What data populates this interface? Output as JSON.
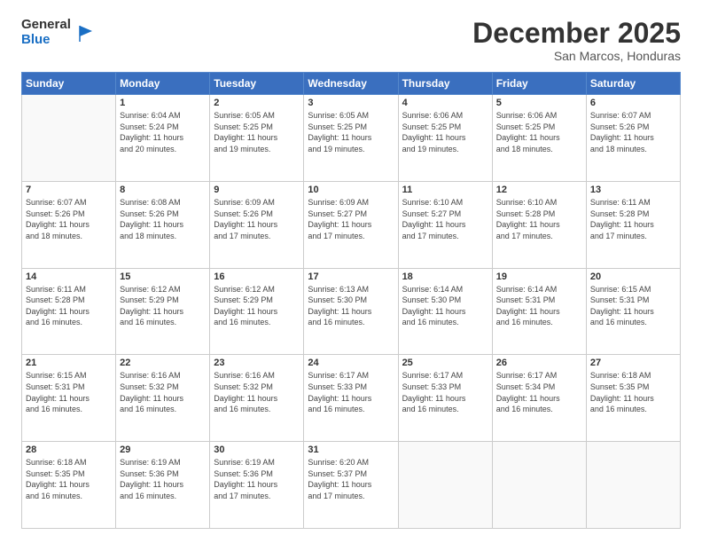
{
  "header": {
    "logo_general": "General",
    "logo_blue": "Blue",
    "month_title": "December 2025",
    "location": "San Marcos, Honduras"
  },
  "weekdays": [
    "Sunday",
    "Monday",
    "Tuesday",
    "Wednesday",
    "Thursday",
    "Friday",
    "Saturday"
  ],
  "weeks": [
    [
      {
        "day": "",
        "info": ""
      },
      {
        "day": "1",
        "info": "Sunrise: 6:04 AM\nSunset: 5:24 PM\nDaylight: 11 hours\nand 20 minutes."
      },
      {
        "day": "2",
        "info": "Sunrise: 6:05 AM\nSunset: 5:25 PM\nDaylight: 11 hours\nand 19 minutes."
      },
      {
        "day": "3",
        "info": "Sunrise: 6:05 AM\nSunset: 5:25 PM\nDaylight: 11 hours\nand 19 minutes."
      },
      {
        "day": "4",
        "info": "Sunrise: 6:06 AM\nSunset: 5:25 PM\nDaylight: 11 hours\nand 19 minutes."
      },
      {
        "day": "5",
        "info": "Sunrise: 6:06 AM\nSunset: 5:25 PM\nDaylight: 11 hours\nand 18 minutes."
      },
      {
        "day": "6",
        "info": "Sunrise: 6:07 AM\nSunset: 5:26 PM\nDaylight: 11 hours\nand 18 minutes."
      }
    ],
    [
      {
        "day": "7",
        "info": "Sunrise: 6:07 AM\nSunset: 5:26 PM\nDaylight: 11 hours\nand 18 minutes."
      },
      {
        "day": "8",
        "info": "Sunrise: 6:08 AM\nSunset: 5:26 PM\nDaylight: 11 hours\nand 18 minutes."
      },
      {
        "day": "9",
        "info": "Sunrise: 6:09 AM\nSunset: 5:26 PM\nDaylight: 11 hours\nand 17 minutes."
      },
      {
        "day": "10",
        "info": "Sunrise: 6:09 AM\nSunset: 5:27 PM\nDaylight: 11 hours\nand 17 minutes."
      },
      {
        "day": "11",
        "info": "Sunrise: 6:10 AM\nSunset: 5:27 PM\nDaylight: 11 hours\nand 17 minutes."
      },
      {
        "day": "12",
        "info": "Sunrise: 6:10 AM\nSunset: 5:28 PM\nDaylight: 11 hours\nand 17 minutes."
      },
      {
        "day": "13",
        "info": "Sunrise: 6:11 AM\nSunset: 5:28 PM\nDaylight: 11 hours\nand 17 minutes."
      }
    ],
    [
      {
        "day": "14",
        "info": "Sunrise: 6:11 AM\nSunset: 5:28 PM\nDaylight: 11 hours\nand 16 minutes."
      },
      {
        "day": "15",
        "info": "Sunrise: 6:12 AM\nSunset: 5:29 PM\nDaylight: 11 hours\nand 16 minutes."
      },
      {
        "day": "16",
        "info": "Sunrise: 6:12 AM\nSunset: 5:29 PM\nDaylight: 11 hours\nand 16 minutes."
      },
      {
        "day": "17",
        "info": "Sunrise: 6:13 AM\nSunset: 5:30 PM\nDaylight: 11 hours\nand 16 minutes."
      },
      {
        "day": "18",
        "info": "Sunrise: 6:14 AM\nSunset: 5:30 PM\nDaylight: 11 hours\nand 16 minutes."
      },
      {
        "day": "19",
        "info": "Sunrise: 6:14 AM\nSunset: 5:31 PM\nDaylight: 11 hours\nand 16 minutes."
      },
      {
        "day": "20",
        "info": "Sunrise: 6:15 AM\nSunset: 5:31 PM\nDaylight: 11 hours\nand 16 minutes."
      }
    ],
    [
      {
        "day": "21",
        "info": "Sunrise: 6:15 AM\nSunset: 5:31 PM\nDaylight: 11 hours\nand 16 minutes."
      },
      {
        "day": "22",
        "info": "Sunrise: 6:16 AM\nSunset: 5:32 PM\nDaylight: 11 hours\nand 16 minutes."
      },
      {
        "day": "23",
        "info": "Sunrise: 6:16 AM\nSunset: 5:32 PM\nDaylight: 11 hours\nand 16 minutes."
      },
      {
        "day": "24",
        "info": "Sunrise: 6:17 AM\nSunset: 5:33 PM\nDaylight: 11 hours\nand 16 minutes."
      },
      {
        "day": "25",
        "info": "Sunrise: 6:17 AM\nSunset: 5:33 PM\nDaylight: 11 hours\nand 16 minutes."
      },
      {
        "day": "26",
        "info": "Sunrise: 6:17 AM\nSunset: 5:34 PM\nDaylight: 11 hours\nand 16 minutes."
      },
      {
        "day": "27",
        "info": "Sunrise: 6:18 AM\nSunset: 5:35 PM\nDaylight: 11 hours\nand 16 minutes."
      }
    ],
    [
      {
        "day": "28",
        "info": "Sunrise: 6:18 AM\nSunset: 5:35 PM\nDaylight: 11 hours\nand 16 minutes."
      },
      {
        "day": "29",
        "info": "Sunrise: 6:19 AM\nSunset: 5:36 PM\nDaylight: 11 hours\nand 16 minutes."
      },
      {
        "day": "30",
        "info": "Sunrise: 6:19 AM\nSunset: 5:36 PM\nDaylight: 11 hours\nand 17 minutes."
      },
      {
        "day": "31",
        "info": "Sunrise: 6:20 AM\nSunset: 5:37 PM\nDaylight: 11 hours\nand 17 minutes."
      },
      {
        "day": "",
        "info": ""
      },
      {
        "day": "",
        "info": ""
      },
      {
        "day": "",
        "info": ""
      }
    ]
  ]
}
